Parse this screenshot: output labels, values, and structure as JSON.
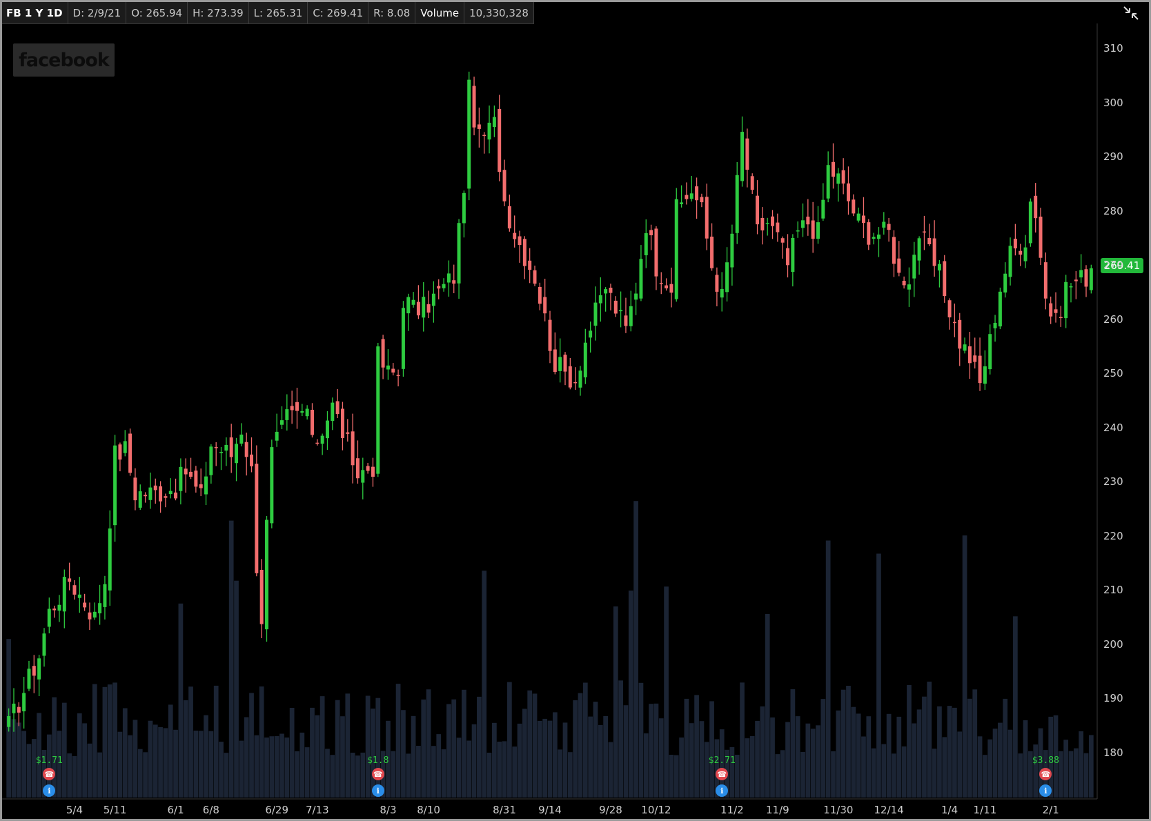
{
  "header": {
    "symbol_label": "FB 1 Y 1D",
    "date": "D: 2/9/21",
    "open": "O: 265.94",
    "high": "H: 273.39",
    "low": "L: 265.31",
    "close": "C: 269.41",
    "range": "R: 8.08",
    "volume_label": "Volume",
    "volume_value": "10,330,328"
  },
  "logo_text": "facebook",
  "last_price": "269.41",
  "icons": {
    "expand": "expand-collapse-icon",
    "earnings": "phone-icon",
    "tip": "lightbulb-icon"
  },
  "colors": {
    "up": "#2ecc40",
    "down": "#f26d6d",
    "volume": "#1b2434",
    "last_price_bg": "#22b83a"
  },
  "events": [
    {
      "date": "4/29",
      "dividend": "$1.71"
    },
    {
      "date": "7/29",
      "dividend": "$1.8"
    },
    {
      "date": "10/29",
      "dividend": "$2.71"
    },
    {
      "date": "1/27",
      "dividend": "$3.88"
    }
  ],
  "chart_data": {
    "type": "candlestick",
    "ylim": [
      171,
      312
    ],
    "y_ticks": [
      180,
      190,
      200,
      210,
      220,
      230,
      240,
      250,
      260,
      270,
      280,
      290,
      300,
      310
    ],
    "x_ticks": [
      "5/4",
      "5/11",
      "6/1",
      "6/8",
      "6/29",
      "7/13",
      "8/3",
      "8/10",
      "8/31",
      "9/14",
      "9/28",
      "10/12",
      "11/2",
      "11/9",
      "11/30",
      "12/14",
      "1/4",
      "1/11",
      "2/1"
    ],
    "x_tick_index": [
      13,
      21,
      33,
      40,
      53,
      61,
      75,
      83,
      98,
      107,
      119,
      128,
      143,
      152,
      164,
      174,
      186,
      193,
      206
    ],
    "anchors": [
      [
        0,
        185
      ],
      [
        6,
        198
      ],
      [
        8,
        206
      ],
      [
        12,
        212
      ],
      [
        17,
        205
      ],
      [
        19,
        212
      ],
      [
        21,
        235
      ],
      [
        23,
        236
      ],
      [
        25,
        228
      ],
      [
        29,
        228
      ],
      [
        33,
        229
      ],
      [
        35,
        232
      ],
      [
        38,
        227
      ],
      [
        40,
        237
      ],
      [
        44,
        235
      ],
      [
        46,
        240
      ],
      [
        48,
        232
      ],
      [
        49,
        215
      ],
      [
        50,
        205
      ],
      [
        51,
        222
      ],
      [
        52,
        235
      ],
      [
        55,
        242
      ],
      [
        58,
        243
      ],
      [
        61,
        238
      ],
      [
        64,
        244
      ],
      [
        67,
        237
      ],
      [
        68,
        231
      ],
      [
        72,
        233
      ],
      [
        73,
        253
      ],
      [
        75,
        250
      ],
      [
        77,
        250
      ],
      [
        78,
        264
      ],
      [
        80,
        262
      ],
      [
        82,
        262
      ],
      [
        88,
        268
      ],
      [
        90,
        285
      ],
      [
        91,
        302
      ],
      [
        93,
        293
      ],
      [
        96,
        296
      ],
      [
        98,
        282
      ],
      [
        100,
        276
      ],
      [
        102,
        272
      ],
      [
        104,
        268
      ],
      [
        106,
        260
      ],
      [
        108,
        252
      ],
      [
        110,
        250
      ],
      [
        112,
        249
      ],
      [
        114,
        256
      ],
      [
        116,
        261
      ],
      [
        118,
        266
      ],
      [
        120,
        262
      ],
      [
        122,
        258
      ],
      [
        124,
        266
      ],
      [
        126,
        278
      ],
      [
        128,
        270
      ],
      [
        131,
        266
      ],
      [
        132,
        280
      ],
      [
        135,
        284
      ],
      [
        137,
        280
      ],
      [
        139,
        270
      ],
      [
        141,
        264
      ],
      [
        143,
        276
      ],
      [
        145,
        294
      ],
      [
        146,
        288
      ],
      [
        148,
        276
      ],
      [
        150,
        278
      ],
      [
        152,
        275
      ],
      [
        154,
        270
      ],
      [
        156,
        276
      ],
      [
        158,
        278
      ],
      [
        160,
        276
      ],
      [
        162,
        288
      ],
      [
        164,
        286
      ],
      [
        166,
        282
      ],
      [
        168,
        278
      ],
      [
        170,
        276
      ],
      [
        172,
        276
      ],
      [
        174,
        276
      ],
      [
        176,
        268
      ],
      [
        178,
        268
      ],
      [
        180,
        276
      ],
      [
        182,
        272
      ],
      [
        184,
        268
      ],
      [
        186,
        262
      ],
      [
        188,
        256
      ],
      [
        190,
        253
      ],
      [
        192,
        248
      ],
      [
        194,
        256
      ],
      [
        196,
        266
      ],
      [
        198,
        272
      ],
      [
        201,
        275
      ],
      [
        202,
        282
      ],
      [
        203,
        280
      ],
      [
        205,
        264
      ],
      [
        207,
        259
      ],
      [
        209,
        266
      ],
      [
        211,
        267
      ],
      [
        213,
        268
      ],
      [
        214,
        269.41
      ]
    ],
    "last_close": 269.41,
    "bars": 215
  }
}
